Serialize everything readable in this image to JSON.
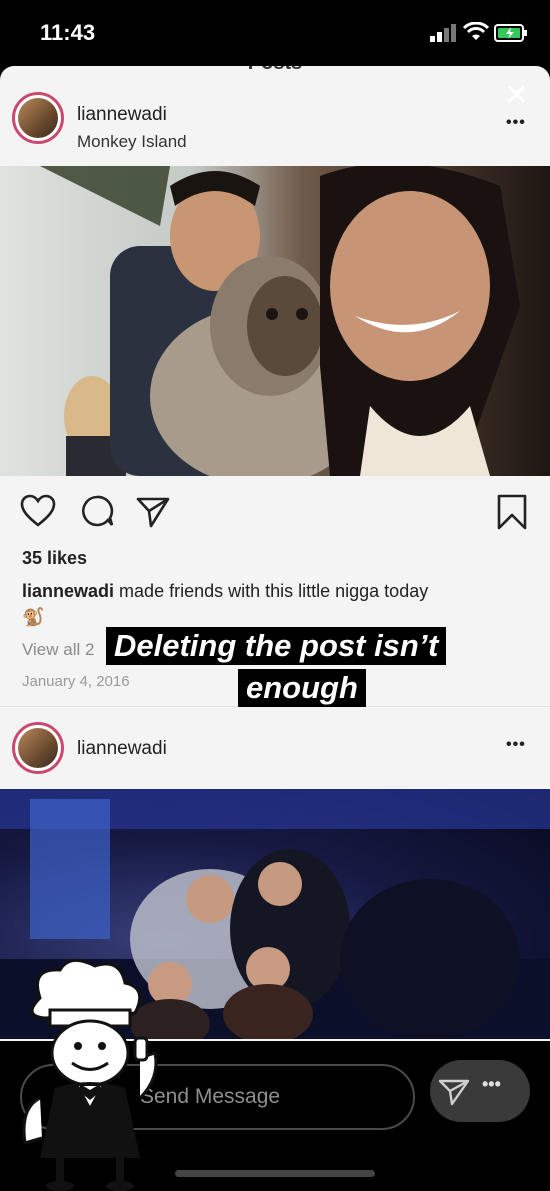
{
  "status_bar": {
    "time": "11:43"
  },
  "story": {
    "header_title": "Posts",
    "close_symbol": "✕",
    "more_symbol": "•••"
  },
  "post1": {
    "username": "liannewadi",
    "location": "Monkey Island",
    "likes": "35 likes",
    "caption_user": "liannewadi",
    "caption_text": "made friends with this little nigga today",
    "caption_emoji": "🐒",
    "view_comments": "View all 2",
    "date": "January 4, 2016",
    "photo_icon": "selfie-with-monkey-photo"
  },
  "post2": {
    "username": "liannewadi",
    "more_symbol": "•••",
    "photo_icon": "nightclub-group-photo"
  },
  "overlay": {
    "line1": "Deleting the post isn’t",
    "line2": "enough"
  },
  "message_bar": {
    "placeholder": "Send Message",
    "more_symbol": "•••"
  },
  "icons": {
    "heart": "heart-icon",
    "comment": "comment-icon",
    "share": "send-icon",
    "bookmark": "bookmark-icon"
  },
  "colors": {
    "story_ring": "#c94a6e",
    "background": "#000000",
    "card": "#f4f4f4"
  }
}
